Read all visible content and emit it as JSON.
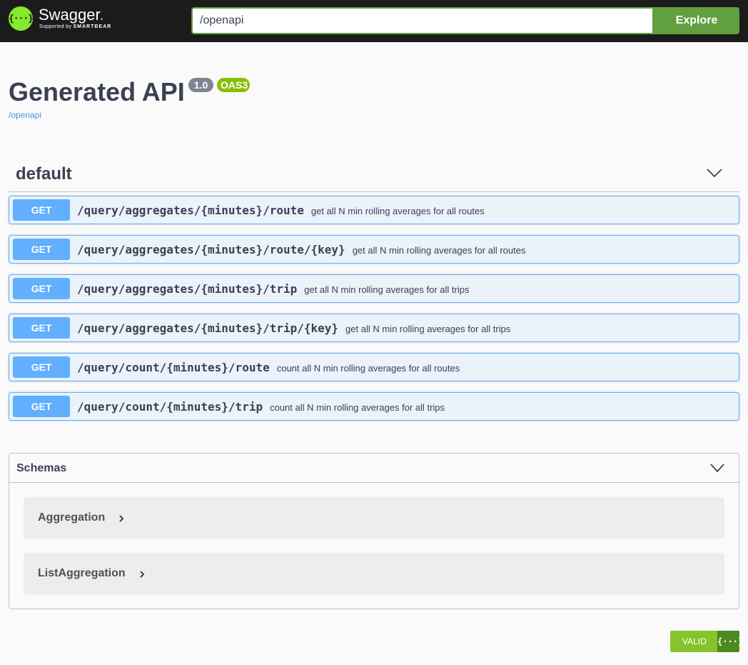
{
  "header": {
    "logo_title": "Swagger",
    "logo_dot": ".",
    "logo_sub_prefix": "Supported by ",
    "logo_sub_brand": "SMARTBEAR",
    "logo_glyph": "{···}",
    "url_value": "/openapi",
    "explore_label": "Explore"
  },
  "info": {
    "title": "Generated API",
    "version": "1.0",
    "oas": "OAS3",
    "url": "/openapi"
  },
  "section": {
    "title": "default"
  },
  "operations": [
    {
      "method": "GET",
      "path": "/query/aggregates/{minutes}/route",
      "summary": "get all N min rolling averages for all routes"
    },
    {
      "method": "GET",
      "path": "/query/aggregates/{minutes}/route/{key}",
      "summary": "get all N min rolling averages for all routes"
    },
    {
      "method": "GET",
      "path": "/query/aggregates/{minutes}/trip",
      "summary": "get all N min rolling averages for all trips"
    },
    {
      "method": "GET",
      "path": "/query/aggregates/{minutes}/trip/{key}",
      "summary": "get all N min rolling averages for all trips"
    },
    {
      "method": "GET",
      "path": "/query/count/{minutes}/route",
      "summary": "count all N min rolling averages for all routes"
    },
    {
      "method": "GET",
      "path": "/query/count/{minutes}/trip",
      "summary": "count all N min rolling averages for all trips"
    }
  ],
  "schemas": {
    "title": "Schemas",
    "models": [
      "Aggregation",
      "ListAggregation"
    ]
  },
  "validator": {
    "label": "VALID",
    "glyph": "{···}"
  },
  "colors": {
    "topbar": "#1b1b1b",
    "accent_green": "#62a03f",
    "get_blue": "#61affe"
  }
}
